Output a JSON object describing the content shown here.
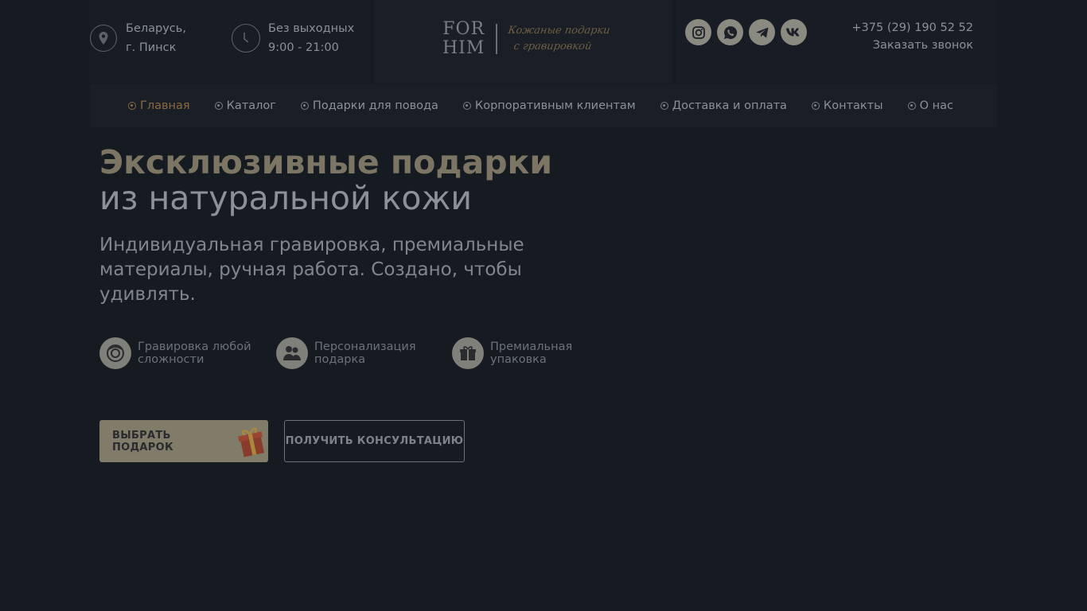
{
  "header": {
    "location_line1": "Беларусь,",
    "location_line2": "г. Пинск",
    "hours_line1": "Без выходных",
    "hours_line2": "9:00 - 21:00",
    "logo_line1": "FOR",
    "logo_line2": "HIM",
    "logo_script_line1": "Кожаные подарки",
    "logo_script_line2": "с гравировкой",
    "phone": "+375 (29) 190 52 52",
    "callback": "Заказать звонок"
  },
  "socials": [
    "instagram-icon",
    "whatsapp-icon",
    "telegram-icon",
    "vk-icon"
  ],
  "nav": {
    "items": [
      {
        "label": "Главная",
        "active": true
      },
      {
        "label": "Каталог"
      },
      {
        "label": "Подарки для повода"
      },
      {
        "label": "Корпоративным клиентам"
      },
      {
        "label": "Доставка и оплата"
      },
      {
        "label": "Контакты"
      },
      {
        "label": "О нас"
      }
    ]
  },
  "hero": {
    "title_line1": "Эксклюзивные подарки",
    "title_line2": "из натуральной кожи",
    "subtitle": "Индивидуальная гравировка, премиальные материалы, ручная работа. Создано, чтобы удивлять.",
    "features": [
      {
        "line1": "Гравировка любой",
        "line2": "сложности",
        "icon": "engraving-icon"
      },
      {
        "line1": "Персонализация",
        "line2": "подарка",
        "icon": "people-icon"
      },
      {
        "line1": "Премиальная",
        "line2": "упаковка",
        "icon": "gift-box-icon"
      }
    ],
    "primary_button": "ВЫБРАТЬ ПОДАРОК",
    "secondary_button": "ПОЛУЧИТЬ КОНСУЛЬТАЦИЮ"
  },
  "colors": {
    "background": "#161a21",
    "accent": "#8a6a3e",
    "button_primary": "#817b69"
  }
}
